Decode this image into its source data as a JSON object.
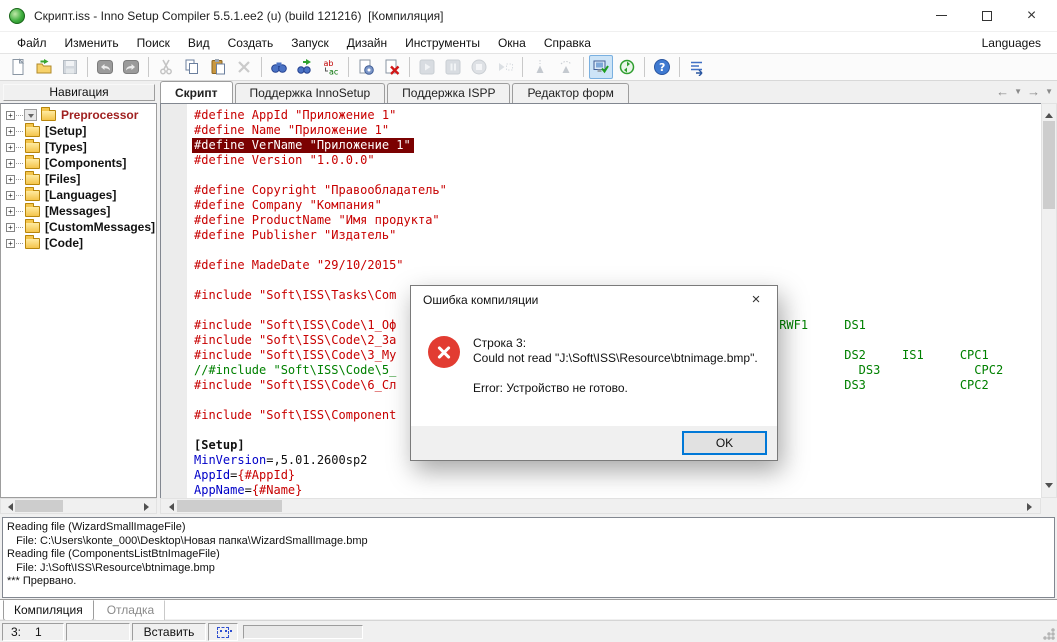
{
  "window": {
    "title": "Скрипт.iss - Inno Setup Compiler 5.5.1.ee2 (u) (build 121216)  [Компиляция]"
  },
  "menu": {
    "items": [
      "Файл",
      "Изменить",
      "Поиск",
      "Вид",
      "Создать",
      "Запуск",
      "Дизайн",
      "Инструменты",
      "Окна",
      "Справка"
    ],
    "right_item": "Languages"
  },
  "toolbar": [
    {
      "name": "new-file"
    },
    {
      "name": "open-file"
    },
    {
      "name": "save-file",
      "disabled": true
    },
    {
      "sep": true
    },
    {
      "name": "undo"
    },
    {
      "name": "redo"
    },
    {
      "sep": true
    },
    {
      "name": "cut",
      "disabled": true
    },
    {
      "name": "copy"
    },
    {
      "name": "paste"
    },
    {
      "name": "delete",
      "disabled": true
    },
    {
      "sep": true
    },
    {
      "name": "find"
    },
    {
      "name": "find-next"
    },
    {
      "name": "replace"
    },
    {
      "sep": true
    },
    {
      "name": "compile"
    },
    {
      "name": "abort-compile"
    },
    {
      "sep": true
    },
    {
      "name": "run",
      "disabled": true
    },
    {
      "name": "pause",
      "disabled": true
    },
    {
      "name": "stop",
      "disabled": true
    },
    {
      "name": "run-to-cursor",
      "disabled": true
    },
    {
      "sep": true
    },
    {
      "name": "step-into",
      "disabled": true
    },
    {
      "name": "step-over",
      "disabled": true
    },
    {
      "sep": true
    },
    {
      "name": "setup-wizard",
      "active": true
    },
    {
      "name": "uninstall-setup"
    },
    {
      "sep": true
    },
    {
      "name": "help"
    },
    {
      "sep": true
    },
    {
      "name": "output-jump"
    }
  ],
  "nav": {
    "header": "Навигация",
    "items": [
      {
        "name": "preprocessor",
        "label": "Preprocessor",
        "color": "#a02020",
        "dropdown": true
      },
      {
        "name": "setup",
        "label": "[Setup]"
      },
      {
        "name": "types",
        "label": "[Types]"
      },
      {
        "name": "components",
        "label": "[Components]"
      },
      {
        "name": "files",
        "label": "[Files]"
      },
      {
        "name": "languages",
        "label": "[Languages]"
      },
      {
        "name": "messages",
        "label": "[Messages]"
      },
      {
        "name": "custommessages",
        "label": "[CustomMessages]"
      },
      {
        "name": "code",
        "label": "[Code]"
      }
    ]
  },
  "tabs": {
    "items": [
      {
        "name": "tab-script",
        "label": "Скрипт",
        "active": true
      },
      {
        "name": "tab-innosetup-support",
        "label": "Поддержка InnoSetup"
      },
      {
        "name": "tab-ispp-support",
        "label": "Поддержка ISPP"
      },
      {
        "name": "tab-form-editor",
        "label": "Редактор форм"
      }
    ]
  },
  "editor": {
    "lines": [
      {
        "segs": [
          {
            "t": "#define AppId \"Приложение 1\"",
            "c": "r"
          }
        ]
      },
      {
        "segs": [
          {
            "t": "#define Name \"Приложение 1\"",
            "c": "r"
          }
        ]
      },
      {
        "hl": true,
        "segs": [
          {
            "t": "#define VerName \"Приложение 1\"",
            "c": "w"
          }
        ]
      },
      {
        "segs": [
          {
            "t": "#define Version \"1.0.0.0\"",
            "c": "r"
          }
        ]
      },
      {
        "segs": []
      },
      {
        "segs": [
          {
            "t": "#define Copyright \"Правообладатель\"",
            "c": "r"
          }
        ]
      },
      {
        "segs": [
          {
            "t": "#define Company \"Компания\"",
            "c": "r"
          }
        ]
      },
      {
        "segs": [
          {
            "t": "#define ProductName \"Имя продукта\"",
            "c": "r"
          }
        ]
      },
      {
        "segs": [
          {
            "t": "#define Publisher \"Издатель\"",
            "c": "r"
          }
        ]
      },
      {
        "segs": []
      },
      {
        "segs": [
          {
            "t": "#define MadeDate \"29/10/2015\"",
            "c": "r"
          }
        ]
      },
      {
        "segs": []
      },
      {
        "segs": [
          {
            "t": "#include \"Soft\\ISS\\Tasks\\Com",
            "c": "r"
          }
        ]
      },
      {
        "segs": []
      },
      {
        "segs": [
          {
            "t": "#include \"Soft\\ISS\\Code\\1_Оф",
            "c": "r"
          },
          {
            "t": "                                                     ",
            "c": "k"
          },
          {
            "t": "RWF1     DS1",
            "c": "g"
          }
        ]
      },
      {
        "segs": [
          {
            "t": "#include \"Soft\\ISS\\Code\\2_За",
            "c": "r"
          }
        ]
      },
      {
        "segs": [
          {
            "t": "#include \"Soft\\ISS\\Code\\3_My",
            "c": "r"
          },
          {
            "t": "                                                              ",
            "c": "k"
          },
          {
            "t": "DS2     IS1     CPC1",
            "c": "g"
          }
        ]
      },
      {
        "segs": [
          {
            "t": "//#include \"Soft\\ISS\\Code\\5_",
            "c": "g"
          },
          {
            "t": "                                                                ",
            "c": "k"
          },
          {
            "t": "DS3             CPC2",
            "c": "g"
          }
        ]
      },
      {
        "segs": [
          {
            "t": "#include \"Soft\\ISS\\Code\\6_Сл",
            "c": "r"
          },
          {
            "t": "                                                              ",
            "c": "k"
          },
          {
            "t": "DS3             CPC2",
            "c": "g"
          }
        ]
      },
      {
        "segs": []
      },
      {
        "segs": [
          {
            "t": "#include \"Soft\\ISS\\Component",
            "c": "r"
          }
        ]
      },
      {
        "segs": []
      },
      {
        "segs": [
          {
            "t": "[Setup]",
            "c": "s"
          }
        ]
      },
      {
        "segs": [
          {
            "t": "MinVersion",
            "c": "b"
          },
          {
            "t": "=,5.01.2600sp2",
            "c": "k"
          }
        ]
      },
      {
        "segs": [
          {
            "t": "AppId",
            "c": "b"
          },
          {
            "t": "=",
            "c": "k"
          },
          {
            "t": "{#AppId}",
            "c": "r"
          }
        ]
      },
      {
        "segs": [
          {
            "t": "AppName",
            "c": "b"
          },
          {
            "t": "=",
            "c": "k"
          },
          {
            "t": "{#Name}",
            "c": "r"
          }
        ]
      }
    ]
  },
  "dialog": {
    "title": "Ошибка компиляции",
    "message_lines": [
      "Строка 3:",
      "Could not read \"J:\\Soft\\ISS\\Resource\\btnimage.bmp\".",
      "",
      "Error: Устройство не готово."
    ],
    "ok_label": "OK"
  },
  "log": {
    "lines": [
      "Reading file (WizardSmallImageFile)",
      "   File: C:\\Users\\konte_000\\Desktop\\Новая папка\\WizardSmallImage.bmp",
      "Reading file (ComponentsListBtnImageFile)",
      "   File: J:\\Soft\\ISS\\Resource\\btnimage.bmp",
      "*** Прервано."
    ]
  },
  "bottom_tabs": [
    {
      "name": "tab-compilation",
      "label": "Компиляция",
      "active": true
    },
    {
      "name": "tab-debug",
      "label": "Отладка"
    }
  ],
  "status": {
    "line": "3:",
    "col": "1",
    "mode": "Вставить"
  }
}
